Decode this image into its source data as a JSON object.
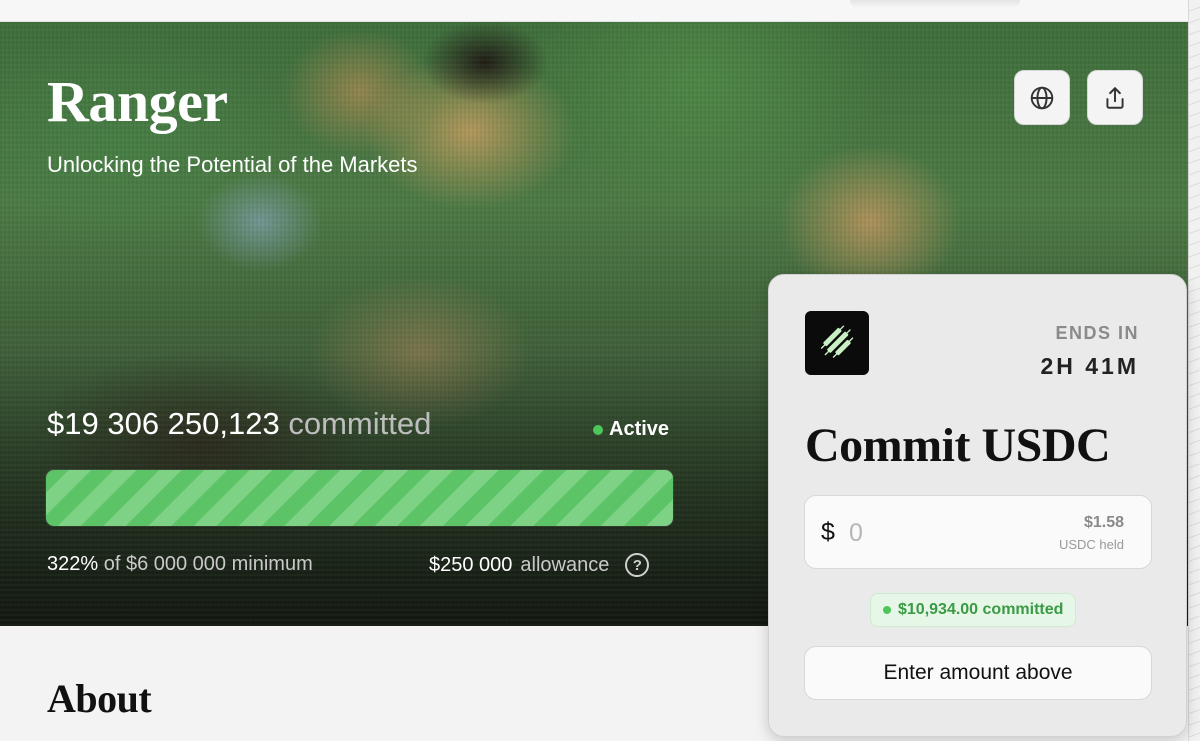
{
  "hero": {
    "title": "Ranger",
    "subtitle": "Unlocking the Potential of the Markets",
    "committed_amount": "$19 306 250,123",
    "committed_label": "committed",
    "status": "Active",
    "progress_percent": 100,
    "percent_of_min": "322%",
    "min_text": "of $6 000 000 minimum",
    "allowance_value": "$250 000",
    "allowance_label": "allowance",
    "help_glyph": "?"
  },
  "toolbar": {
    "globe_icon": "globe-icon",
    "share_icon": "share-icon"
  },
  "commit_card": {
    "ends_in_label": "ENDS IN",
    "ends_in_value": "2H 41M",
    "heading": "Commit USDC",
    "currency_symbol": "$",
    "amount_placeholder": "0",
    "held_value": "$1.58",
    "held_label": "USDC held",
    "committed_badge": "$10,934.00 committed",
    "button_label": "Enter amount above",
    "logo_icon": "candlestick-logo-icon"
  },
  "about": {
    "heading": "About"
  },
  "colors": {
    "accent_green": "#5cc367",
    "active_dot": "#4cc75a"
  }
}
